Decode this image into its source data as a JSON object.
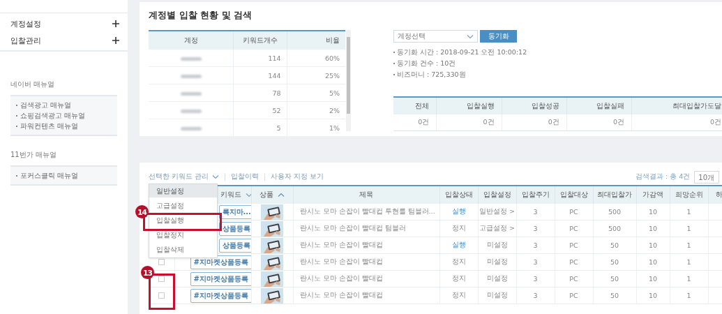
{
  "sidebar": {
    "menu": [
      {
        "label": "계정설정",
        "expanded": false
      },
      {
        "label": "입찰관리",
        "expanded": false
      }
    ],
    "manuals": [
      {
        "title": "네이버 매뉴얼",
        "items": [
          "검색광고 매뉴얼",
          "쇼핑검색광고 매뉴얼",
          "파워컨텐츠 매뉴얼"
        ]
      },
      {
        "title": "11번가 매뉴얼",
        "items": [
          "포커스클릭 매뉴얼"
        ]
      }
    ]
  },
  "status_panel": {
    "title": "계정별 입찰 현황 및 검색",
    "accounts_table": {
      "columns": [
        "계정",
        "키워드개수",
        "비율"
      ],
      "rows": [
        {
          "keywords": "114",
          "ratio": "60%"
        },
        {
          "keywords": "144",
          "ratio": "25%"
        },
        {
          "keywords": "78",
          "ratio": "5%"
        },
        {
          "keywords": "52",
          "ratio": "2%"
        },
        {
          "keywords": "5",
          "ratio": "1%"
        }
      ]
    },
    "sync": {
      "account_select": {
        "placeholder": "계정선택"
      },
      "button": "동기화",
      "info": [
        "동기화 시간 : 2018-09-21 오전 10:00:12",
        "동기화 건수 : 10건",
        "비즈머니 : 725,330원"
      ]
    },
    "summary": {
      "columns": [
        "전체",
        "입찰실행",
        "입찰성공",
        "입찰실패",
        "최대입찰가도달"
      ],
      "values": [
        "0건",
        "0건",
        "0건",
        "0건",
        "0건"
      ]
    }
  },
  "keyword_panel": {
    "toolbar": [
      {
        "label": "선택한 키워드 관리",
        "kind": "dropdown"
      },
      {
        "label": "입찰이력",
        "kind": "link"
      },
      {
        "label": "사용자 지정 보기",
        "kind": "link"
      }
    ],
    "result_count": "검색결과 : 총 4건",
    "page_size": "10개",
    "menu": {
      "items": [
        {
          "label": "일반설정",
          "selected": true
        },
        {
          "label": "고급설정",
          "selected": false
        },
        {
          "label": "입찰실행",
          "selected": false
        },
        {
          "label": "입찰정지",
          "selected": false
        },
        {
          "label": "입찰삭제",
          "selected": false
        }
      ]
    },
    "table": {
      "columns": [
        {
          "label": "키워드",
          "kind": "dropdown"
        },
        {
          "label": "상품",
          "kind": "sort"
        },
        {
          "label": "제목",
          "kind": "plain"
        },
        {
          "label": "입찰상태",
          "kind": "plain"
        },
        {
          "label": "입찰설정",
          "kind": "plain"
        },
        {
          "label": "입찰주기",
          "kind": "plain"
        },
        {
          "label": "입찰대상",
          "kind": "plain"
        },
        {
          "label": "최대입찰가",
          "kind": "plain"
        },
        {
          "label": "가감액",
          "kind": "plain"
        },
        {
          "label": "희망순위",
          "kind": "plain"
        },
        {
          "label": "하",
          "kind": "plain"
        }
      ],
      "rows": [
        {
          "keyword": "록지마...",
          "title": "란시노 모마 손잡이 빨대컵 투현를 텀블러...",
          "status": {
            "label": "실행",
            "active": true
          },
          "setting": "일반설정 >",
          "cycle": "3",
          "target": "PC",
          "max_bid": "500",
          "step": "10",
          "rank": "1"
        },
        {
          "keyword": "상품등록",
          "title": "란시노 모마 손잡이 빨대컵 텀블러",
          "status": {
            "label": "정지",
            "active": false
          },
          "setting": "고급설정 >",
          "cycle": "3",
          "target": "PC",
          "max_bid": "500",
          "step": "10",
          "rank": "1"
        },
        {
          "keyword": "상품등록",
          "title": "란시노 모마 손잡이 빨대컵",
          "status": {
            "label": "실행",
            "active": true
          },
          "setting": "미설정",
          "cycle": "3",
          "target": "PC",
          "max_bid": "50",
          "step": "10",
          "rank": "1"
        },
        {
          "checked": false,
          "keyword": "#지마켓상품등록",
          "title": "란시노 모마 손잡이 빨대컵",
          "status": {
            "label": "정지",
            "active": false
          },
          "setting": "미설정",
          "cycle": "3",
          "target": "PC",
          "max_bid": "50",
          "step": "10",
          "rank": "1"
        },
        {
          "checked": false,
          "keyword": "#지마켓상품등록",
          "title": "란시노 모마 손잡이 빨대컵",
          "status": {
            "label": "정지",
            "active": false
          },
          "setting": "미설정",
          "cycle": "3",
          "target": "PC",
          "max_bid": "50",
          "step": "10",
          "rank": "1"
        },
        {
          "checked": false,
          "keyword": "#지마켓상품등록",
          "title": "란시노 모마 손잡이 빨대컵",
          "status": {
            "label": "정지",
            "active": false
          },
          "setting": "미설정",
          "cycle": "3",
          "target": "PC",
          "max_bid": "50",
          "step": "10",
          "rank": "1"
        }
      ]
    }
  },
  "annotations": [
    {
      "label": "14"
    },
    {
      "label": "13"
    }
  ]
}
